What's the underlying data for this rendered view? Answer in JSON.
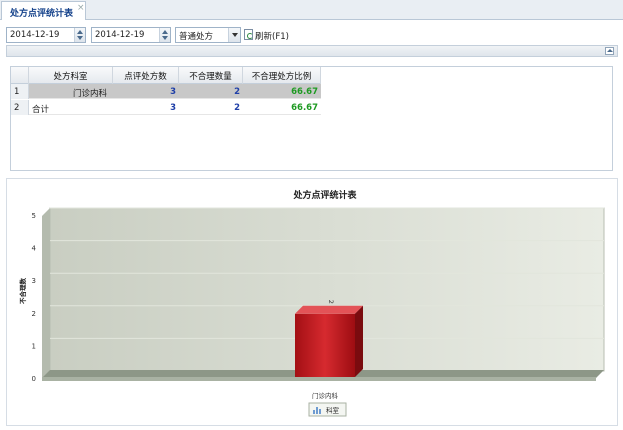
{
  "tab": {
    "title": "处方点评统计表",
    "close": "×"
  },
  "toolbar": {
    "start_date": "2014-12-19",
    "end_date": "2014-12-19",
    "prescription_type": "普通处方",
    "refresh_label": "刷新(F1)"
  },
  "grid": {
    "headers": [
      "处方科室",
      "点评处方数",
      "不合理数量",
      "不合理处方比例"
    ],
    "rows": [
      {
        "num": "1",
        "dept": "门诊内科",
        "reviewed": "3",
        "unreasonable": "2",
        "ratio": "66.67"
      },
      {
        "num": "2",
        "dept": "合计",
        "reviewed": "3",
        "unreasonable": "2",
        "ratio": "66.67"
      }
    ]
  },
  "chart_data": {
    "type": "bar",
    "title": "处方点评统计表",
    "ylabel": "不合理数",
    "xlabel": "",
    "categories": [
      "门诊内科"
    ],
    "series": [
      {
        "name": "科室",
        "values": [
          2
        ]
      }
    ],
    "ylim": [
      0,
      5
    ],
    "yticks": [
      "0",
      "1",
      "2",
      "3",
      "4",
      "5"
    ],
    "data_labels": [
      "2"
    ],
    "legend": "bottom-center",
    "colors": {
      "bar": "#c0141b",
      "bar_top": "#e35357",
      "bar_side": "#7a0b0f",
      "wall": "#d2d6cc",
      "floor": "#8d9787"
    }
  }
}
